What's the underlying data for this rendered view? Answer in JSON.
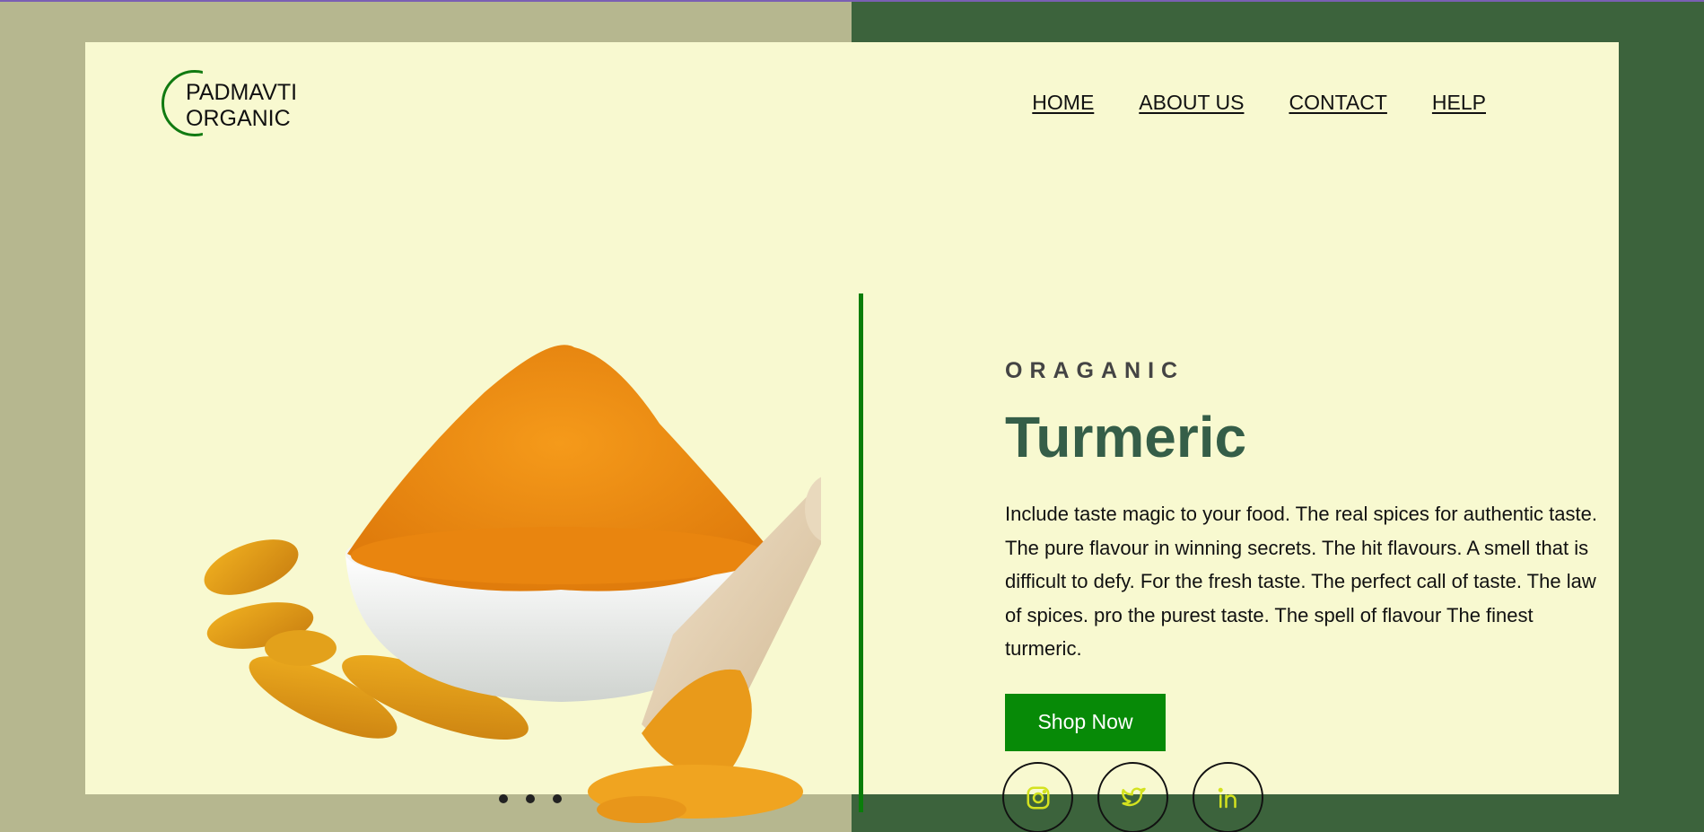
{
  "brand": {
    "line1": "PADMAVTI",
    "line2": "ORGANIC"
  },
  "nav": [
    {
      "label": "HOME"
    },
    {
      "label": "ABOUT US"
    },
    {
      "label": "CONTACT"
    },
    {
      "label": "HELP"
    }
  ],
  "hero": {
    "eyebrow": "ORAGANIC",
    "title": "Turmeric",
    "description": "Include taste magic to your food. The real spices for authentic taste. The pure flavour in winning secrets. The hit flavours. A smell that is difficult to defy. For the fresh taste. The perfect call of taste. The law of spices. pro the purest taste. The spell of flavour The finest turmeric.",
    "cta": "Shop Now"
  },
  "socials": [
    {
      "icon": "instagram-icon"
    },
    {
      "icon": "twitter-icon"
    },
    {
      "icon": "linkedin-icon"
    }
  ],
  "carousel": {
    "slides": 3
  },
  "colors": {
    "left_bg": "#b6b78f",
    "right_bg": "#3c633c",
    "card_bg": "#f8f9d0",
    "accent_green": "#078a07",
    "title_color": "#355e48",
    "icon_color": "#d4e21f"
  }
}
